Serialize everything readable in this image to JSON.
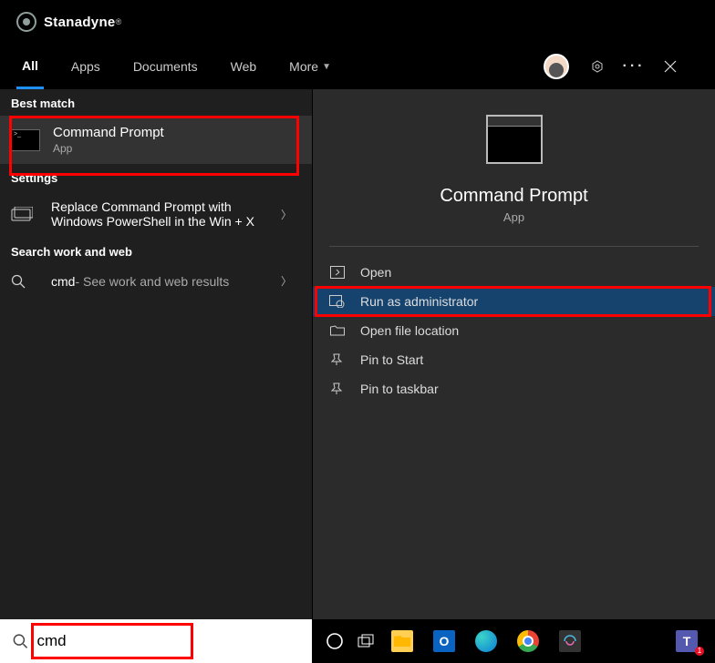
{
  "brand": {
    "name": "Stanadyne"
  },
  "header": {
    "tabs": {
      "all": "All",
      "apps": "Apps",
      "documents": "Documents",
      "web": "Web",
      "more": "More"
    }
  },
  "left": {
    "best_match_label": "Best match",
    "best_match": {
      "title": "Command Prompt",
      "subtitle": "App"
    },
    "settings_label": "Settings",
    "setting_item": {
      "line1": "Replace Command Prompt with",
      "line2": "Windows PowerShell in the Win + X"
    },
    "search_work_label": "Search work and web",
    "web_item": {
      "q": "cmd",
      "hint": " - See work and web results"
    }
  },
  "right": {
    "title": "Command Prompt",
    "subtitle": "App",
    "actions": {
      "open": "Open",
      "run_admin": "Run as administrator",
      "open_loc": "Open file location",
      "pin_start": "Pin to Start",
      "pin_taskbar": "Pin to taskbar"
    }
  },
  "search": {
    "value": "cmd"
  }
}
